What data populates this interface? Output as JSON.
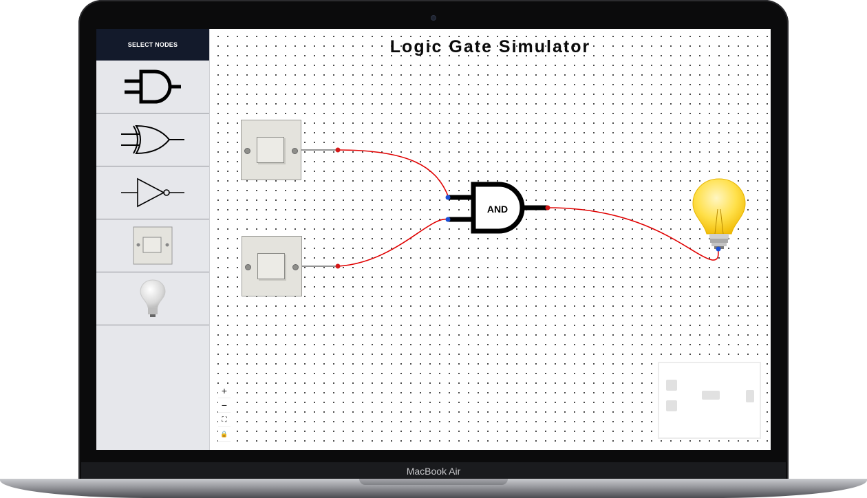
{
  "device": {
    "label": "MacBook Air"
  },
  "sidebar": {
    "header": "SELECT NODES",
    "nodes": [
      {
        "name": "and-gate"
      },
      {
        "name": "or-gate"
      },
      {
        "name": "not-gate"
      },
      {
        "name": "switch"
      },
      {
        "name": "bulb"
      }
    ]
  },
  "canvas": {
    "title": "Logic Gate Simulator",
    "gate_label": "AND",
    "wire_color": "#e00000",
    "handle_input_color": "#1a4fd6",
    "handle_output_color": "#d41818"
  },
  "controls": [
    {
      "name": "zoom-in",
      "glyph": "+"
    },
    {
      "name": "zoom-out",
      "glyph": "−"
    },
    {
      "name": "fit-view",
      "glyph": "⛶"
    },
    {
      "name": "lock",
      "glyph": "🔒"
    }
  ]
}
